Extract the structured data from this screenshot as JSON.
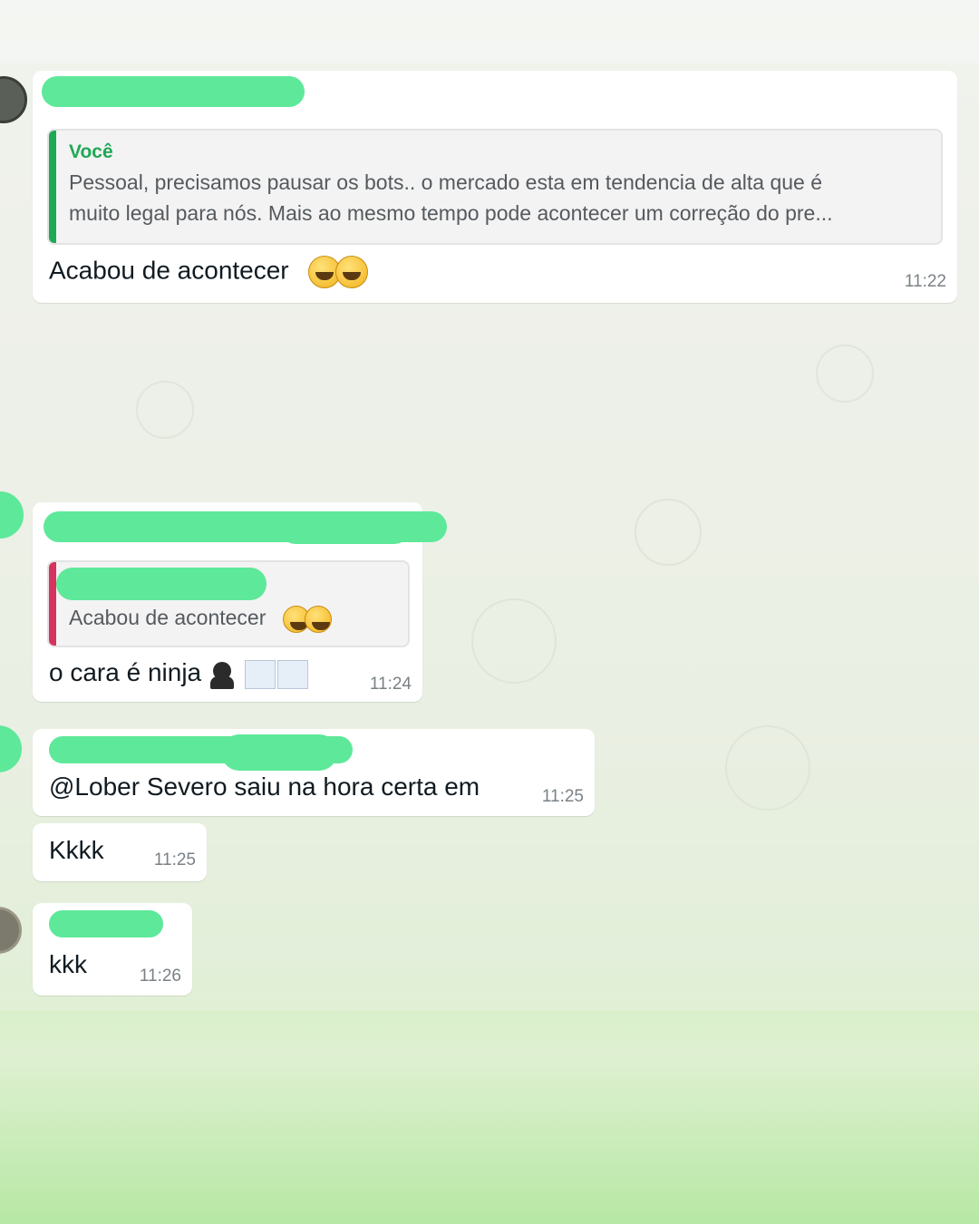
{
  "messages": [
    {
      "quote": {
        "author": "Você",
        "line1": "Pessoal, precisamos pausar os bots.. o mercado esta em tendencia de alta que é",
        "line2": "muito legal para nós. Mais ao mesmo tempo pode acontecer um correção do pre..."
      },
      "text": "Acabou de acontecer",
      "emoji": [
        "grinning-sweat-emoji",
        "grinning-sweat-emoji"
      ],
      "time": "11:22"
    },
    {
      "quote": {
        "text": "Acabou de acontecer",
        "emoji": [
          "grinning-sweat-emoji",
          "grinning-sweat-emoji"
        ]
      },
      "text": "o cara é ninja",
      "emoji": [
        "ninja-emoji",
        "chart-increasing-emoji",
        "chart-decreasing-emoji"
      ],
      "time": "11:24"
    },
    {
      "text": "@Lober Severo saiu na hora certa em",
      "time": "11:25"
    },
    {
      "text": "Kkkk",
      "time": "11:25"
    },
    {
      "text": "kkk",
      "time": "11:26"
    }
  ],
  "colors": {
    "quote_bar_self": "#1fa855",
    "quote_bar_other": "#d6335f",
    "redaction": "#5ee89a",
    "bubble": "#ffffff",
    "bottom_gradient": "#b7e8a4"
  }
}
